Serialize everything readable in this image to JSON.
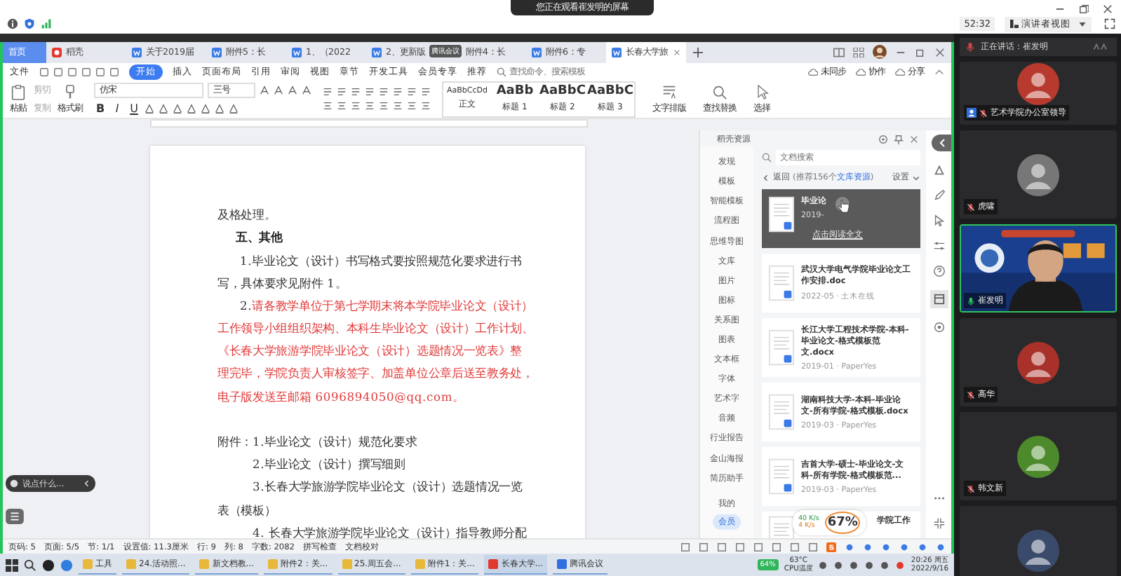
{
  "meeting": {
    "notice": "您正在观看崔发明的屏幕",
    "timer": "52:32",
    "view_button": "演讲者视图"
  },
  "wps": {
    "tabs": [
      {
        "kind": "home",
        "label": "首页",
        "selected": false
      },
      {
        "kind": "daoke",
        "label": "稻壳",
        "selected": false
      },
      {
        "kind": "doc",
        "label": "关于2019届",
        "selected": false
      },
      {
        "kind": "doc",
        "label": "附件5：长",
        "selected": false
      },
      {
        "kind": "doc",
        "label": "1、（2022",
        "selected": false
      },
      {
        "kind": "doc",
        "label": "2、更新版",
        "selected": false
      },
      {
        "kind": "doc",
        "label": "附件4：长",
        "selected": false
      },
      {
        "kind": "doc",
        "label": "附件6：专",
        "selected": false
      },
      {
        "kind": "doc",
        "label": "长春大学旅",
        "selected": true
      }
    ],
    "floating_badge": "腾讯会议",
    "menu": [
      {
        "label": "文件",
        "selected": false
      },
      {
        "label": "开始",
        "selected": true
      },
      {
        "label": "插入",
        "selected": false
      },
      {
        "label": "页面布局",
        "selected": false
      },
      {
        "label": "引用",
        "selected": false
      },
      {
        "label": "审阅",
        "selected": false
      },
      {
        "label": "视图",
        "selected": false
      },
      {
        "label": "章节",
        "selected": false
      },
      {
        "label": "开发工具",
        "selected": false
      },
      {
        "label": "会员专享",
        "selected": false
      },
      {
        "label": "推荐",
        "selected": false
      }
    ],
    "menu_search": {
      "placeholder": "查找命令、搜索模板"
    },
    "menu_actions": [
      "未同步",
      "协作",
      "分享"
    ],
    "ribbon": {
      "paste": "粘贴",
      "cut": "剪切",
      "copy": "复制",
      "format_painter": "格式刷",
      "font": "仿宋",
      "size": "三号",
      "format_buttons": [
        "B",
        "I",
        "U"
      ],
      "styles": [
        {
          "preview": "AaBbCcDd",
          "name": "正文"
        },
        {
          "preview": "AaBb",
          "name": "标题 1"
        },
        {
          "preview": "AaBbC",
          "name": "标题 2"
        },
        {
          "preview": "AaBbC",
          "name": "标题 3"
        }
      ],
      "tools": [
        "文字排版",
        "查找替换",
        "选择"
      ]
    },
    "document": {
      "lines": [
        {
          "kind": "text",
          "text": "及格处理。",
          "color": "#333333"
        },
        {
          "kind": "heading",
          "text": "五、其他",
          "color": "#222222"
        },
        {
          "kind": "item",
          "number": "1.",
          "text": "毕业论文（设计）书写格式要按照规范化要求进行书",
          "color": "#333333"
        },
        {
          "kind": "text",
          "text": "写，具体要求见附件 1。",
          "color": "#333333"
        },
        {
          "kind": "item",
          "number": "2.",
          "text": "请各教学单位于第七学期末将本学院毕业论文（设计）",
          "color": "#e23b3b"
        },
        {
          "kind": "text",
          "text": "工作领导小组组织架构、本科生毕业论文（设计）工作计划、",
          "color": "#e23b3b"
        },
        {
          "kind": "text",
          "text": "《长春大学旅游学院毕业论文（设计）选题情况一览表》整",
          "color": "#e23b3b"
        },
        {
          "kind": "text",
          "text": "理完毕，学院负责人审核签字、加盖单位公章后送至教务处，",
          "color": "#e23b3b"
        },
        {
          "kind": "text",
          "text": "电子版发送至邮箱 6096894050@qq.com。",
          "color": "#e23b3b"
        },
        {
          "kind": "blank"
        },
        {
          "kind": "text",
          "text": "附件：1.毕业论文（设计）规范化要求",
          "color": "#333333"
        },
        {
          "kind": "sub",
          "text": "2.毕业论文（设计）撰写细则",
          "color": "#333333"
        },
        {
          "kind": "sub",
          "text": "3.长春大学旅游学院毕业论文（设计）选题情况一览",
          "color": "#333333"
        },
        {
          "kind": "text",
          "text": "表（模板）",
          "color": "#333333"
        },
        {
          "kind": "sub",
          "text": "4. 长春大学旅游学院毕业论文（设计）指导教师分配",
          "color": "#333333"
        }
      ]
    },
    "chat": {
      "placeholder": "说点什么..."
    },
    "status_bar": [
      "页码: 5",
      "页面: 5/5",
      "节: 1/1",
      "设置值: 11.3厘米",
      "行: 9",
      "列: 8",
      "字数: 2082",
      "拼写检查",
      "文档校对"
    ],
    "resources": {
      "title": "稻壳资源",
      "nav": [
        "发现",
        "模板",
        "智能模板",
        "流程图",
        "思维导图",
        "文库",
        "图片",
        "图标",
        "关系图",
        "图表",
        "文本框",
        "字体",
        "艺术字",
        "音频",
        "行业报告",
        "金山海报",
        "简历助手"
      ],
      "nav_bottom": [
        {
          "label": "我的",
          "kind": "plain"
        },
        {
          "label": "会员",
          "kind": "vip"
        }
      ],
      "search": {
        "placeholder": "文档搜索"
      },
      "back": "返回",
      "count_prefix": "(推荐156个",
      "count_link": "文库资源",
      "count_suffix": ")",
      "settings": "设置",
      "cards": [
        {
          "title": "毕业论",
          "meta": "2019-",
          "hovered": true,
          "action": "点击阅读全文"
        },
        {
          "title": "武汉大学电气学院毕业论文工作安排.doc",
          "meta": "2022-05 · 土木在线",
          "hovered": false
        },
        {
          "title": "长江大学工程技术学院-本科-毕业论文-格式模板范文.docx",
          "meta": "2019-01 · PaperYes",
          "hovered": false
        },
        {
          "title": "湖南科技大学-本科-毕业论文-所有学院-格式模板.docx",
          "meta": "2019-03 · PaperYes",
          "hovered": false
        },
        {
          "title": "吉首大学-硕士-毕业论文-文科-所有学院-格式模板范...",
          "meta": "2019-03 · PaperYes",
          "hovered": false
        },
        {
          "title": "学院工作",
          "hovered": false
        }
      ]
    },
    "speed_widget": {
      "up": "40 K/s",
      "down": "4 K/s",
      "percent": "67%"
    }
  },
  "taskbar": {
    "items": [
      {
        "label": "工具",
        "active": false
      },
      {
        "label": "24.活动照...",
        "active": false
      },
      {
        "label": "新文档教...",
        "active": false
      },
      {
        "label": "附件2：关...",
        "active": false
      },
      {
        "label": "25.周五会...",
        "active": false
      },
      {
        "label": "附件1：关...",
        "active": false
      },
      {
        "label": "长春大学...",
        "active": true
      },
      {
        "label": "腾讯会议",
        "active": false
      }
    ],
    "tray": {
      "badge": "64%",
      "temp": "63°C",
      "temp_label": "CPU温度",
      "time": "20:26 周五",
      "date": "2022/9/16"
    }
  },
  "participants": {
    "speaking": "正在讲话：崔发明",
    "tiles": [
      {
        "kind": "avatar",
        "name": "艺术学院办公室领导",
        "host": true,
        "muted": true,
        "speaking": false
      },
      {
        "kind": "avatar",
        "name": "虎啸",
        "host": false,
        "muted": true,
        "speaking": false
      },
      {
        "kind": "video",
        "name": "崔发明",
        "host": false,
        "muted": false,
        "speaking": true
      },
      {
        "kind": "avatar",
        "name": "高华",
        "host": false,
        "muted": true,
        "speaking": false
      },
      {
        "kind": "avatar",
        "name": "韩文新",
        "host": false,
        "muted": true,
        "speaking": false
      },
      {
        "kind": "avatar",
        "speaking": false
      }
    ]
  }
}
